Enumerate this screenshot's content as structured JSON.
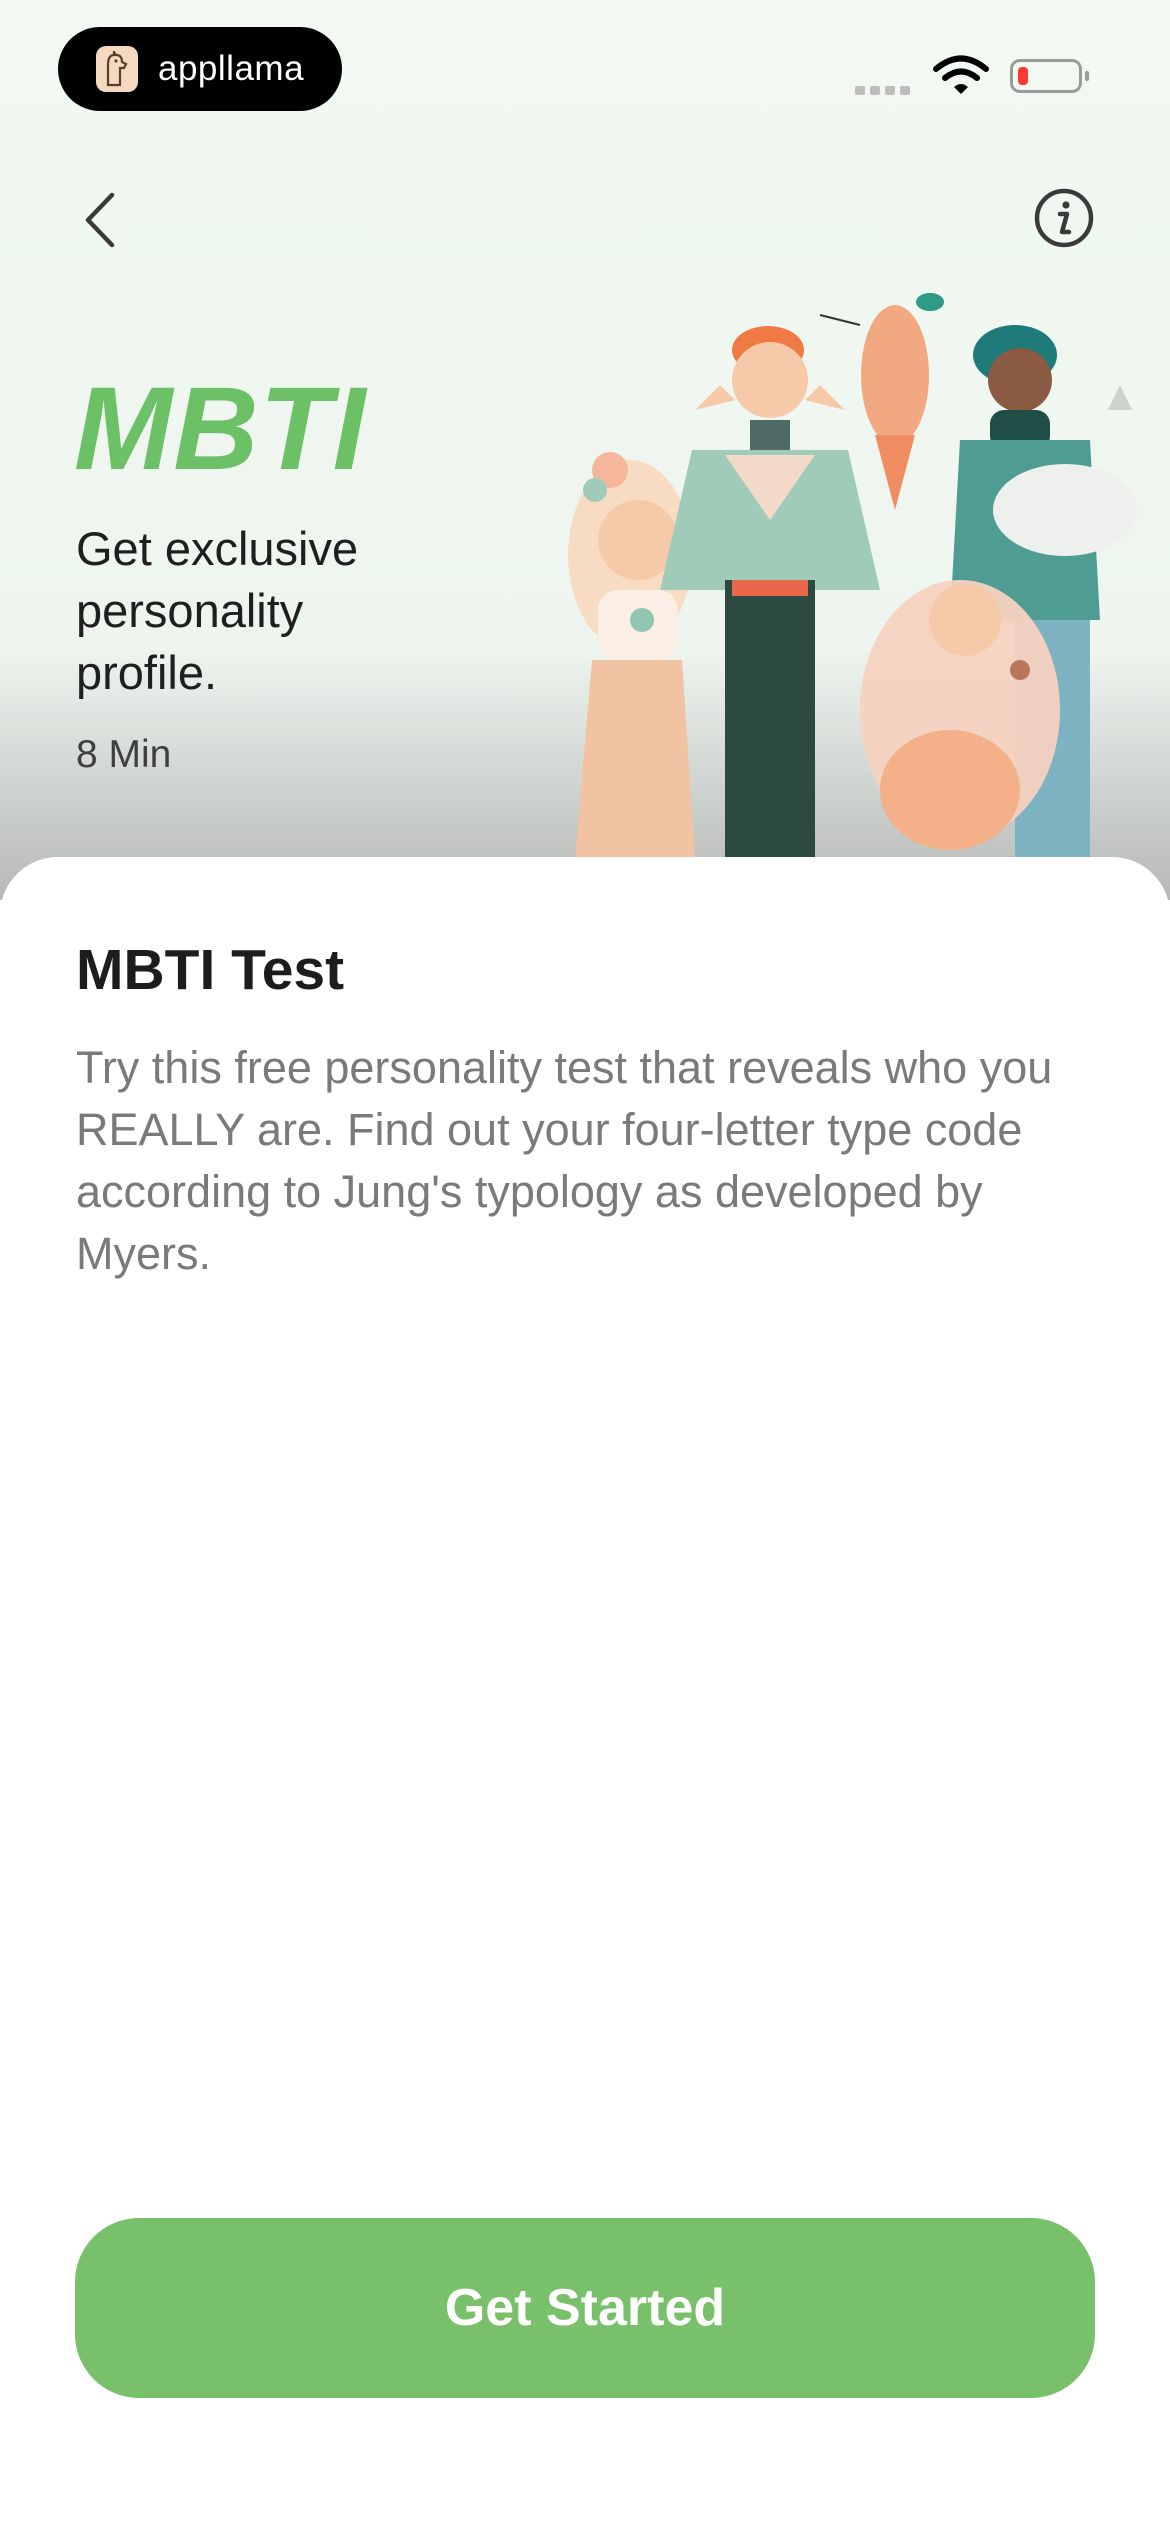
{
  "status_bar": {
    "app_name": "appllama",
    "icons": [
      "cellular-signal-icon",
      "wifi-icon",
      "battery-low-icon"
    ],
    "battery_level": 0.12
  },
  "nav": {
    "back_icon": "chevron-left-icon",
    "info_icon": "info-circle-icon"
  },
  "hero": {
    "title": "MBTI",
    "subtitle": "Get exclusive personality profile.",
    "duration": "8 Min",
    "illustration": "group-of-characters-illustration"
  },
  "card": {
    "title": "MBTI Test",
    "description": "Try this free personality test that reveals who you REALLY are. Find out your four-letter type code according to Jung's typology as developed by Myers."
  },
  "cta": {
    "label": "Get Started"
  },
  "colors": {
    "accent": "#6cc066",
    "button": "#78c06a",
    "hero_background": "#f2f9f3",
    "battery_low": "#ff3b30"
  }
}
